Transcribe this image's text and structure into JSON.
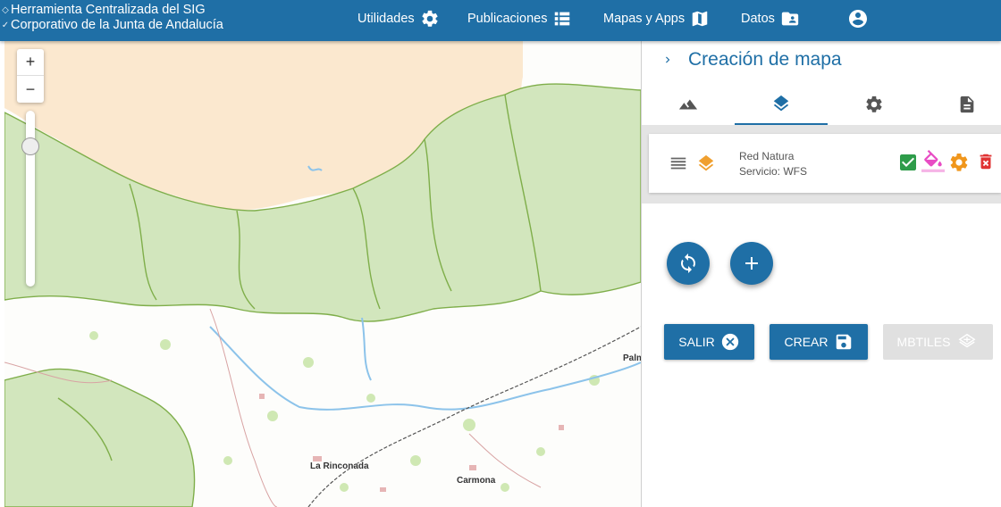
{
  "header": {
    "brand_line1": "Herramienta Centralizada del SIG",
    "brand_line2": "Corporativo de la Junta de Andalucía",
    "nav": [
      {
        "label": "Utilidades",
        "icon": "gear-icon"
      },
      {
        "label": "Publicaciones",
        "icon": "list-icon"
      },
      {
        "label": "Mapas y Apps",
        "icon": "map-icon"
      },
      {
        "label": "Datos",
        "icon": "folder-user-icon"
      }
    ],
    "user_icon": "account-circle-icon"
  },
  "map": {
    "zoom_in": "+",
    "zoom_out": "−",
    "zoom_slider_level": 0.83,
    "places": [
      "La Rinconada",
      "Carmona",
      "Palm"
    ]
  },
  "panel": {
    "title": "Creación de mapa",
    "tabs": [
      {
        "icon": "terrain-icon"
      },
      {
        "icon": "layers-icon",
        "active": true
      },
      {
        "icon": "gear-icon"
      },
      {
        "icon": "document-icon"
      }
    ],
    "layer": {
      "name": "Red Natura",
      "service": "Servicio: WFS",
      "visible": true
    },
    "buttons": {
      "salir": "SALIR",
      "crear": "CREAR",
      "mbtiles": "MBTILES"
    }
  },
  "colors": {
    "primary": "#1f6fa6",
    "check": "#2e9c4a",
    "style": "#e84cc4",
    "gear": "#f0961c",
    "delete": "#e03333",
    "layer": "#f0a030"
  }
}
